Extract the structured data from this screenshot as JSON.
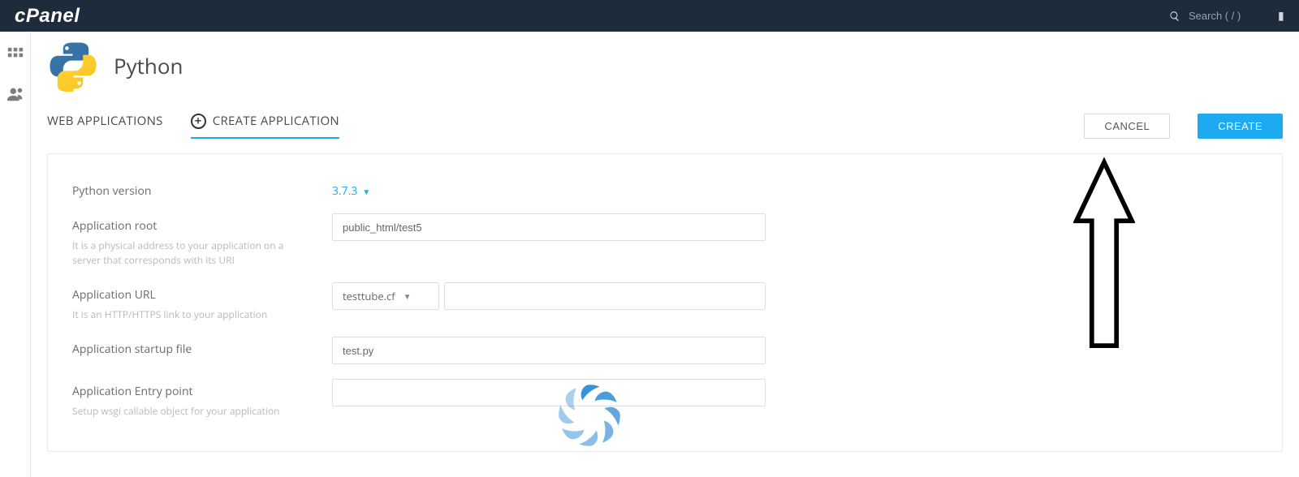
{
  "header": {
    "logo_text": "cPanel",
    "search_placeholder": "Search ( / )"
  },
  "page": {
    "title": "Python"
  },
  "tabs": {
    "web_apps": "WEB APPLICATIONS",
    "create_app": "CREATE APPLICATION"
  },
  "actions": {
    "cancel": "CANCEL",
    "create": "CREATE"
  },
  "form": {
    "python_version": {
      "label": "Python version",
      "value": "3.7.3"
    },
    "app_root": {
      "label": "Application root",
      "value": "public_html/test5",
      "hint": "It is a physical address to your application on a server that corresponds with its URI"
    },
    "app_url": {
      "label": "Application URL",
      "domain": "testtube.cf",
      "path": "",
      "hint": "It is an HTTP/HTTPS link to your application"
    },
    "startup_file": {
      "label": "Application startup file",
      "value": "test.py"
    },
    "entry_point": {
      "label": "Application Entry point",
      "value": "",
      "hint": "Setup wsgi callable object for your application"
    }
  }
}
